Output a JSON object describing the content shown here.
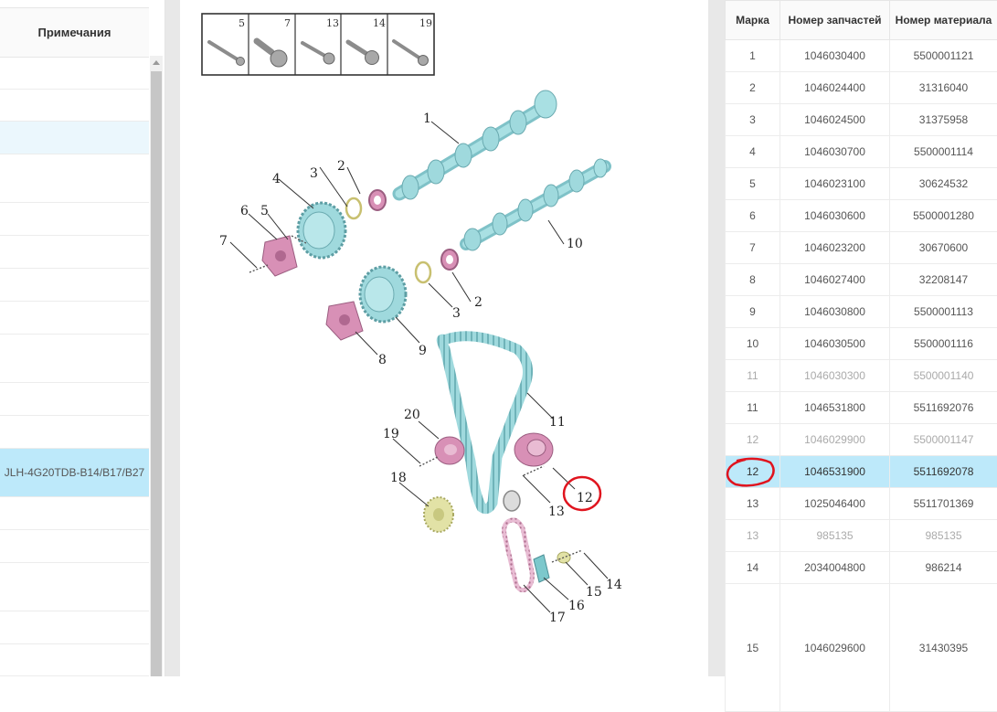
{
  "left_table": {
    "header": "Примечания",
    "selected_note": "JLH-4G20TDB-B14/B17/B27"
  },
  "diagram": {
    "bolt_legend": [
      "5",
      "7",
      "13",
      "14",
      "19"
    ],
    "callouts": [
      "1",
      "2",
      "3",
      "4",
      "5",
      "6",
      "7",
      "10",
      "2",
      "3",
      "8",
      "9",
      "11",
      "20",
      "19",
      "18",
      "12",
      "13",
      "14",
      "15",
      "16",
      "17"
    ]
  },
  "parts_table": {
    "columns": [
      "Марка",
      "Номер запчастей",
      "Номер материала"
    ],
    "rows": [
      {
        "mark": "1",
        "part": "1046030400",
        "material": "5500001121",
        "state": "normal"
      },
      {
        "mark": "2",
        "part": "1046024400",
        "material": "31316040",
        "state": "normal"
      },
      {
        "mark": "3",
        "part": "1046024500",
        "material": "31375958",
        "state": "normal"
      },
      {
        "mark": "4",
        "part": "1046030700",
        "material": "5500001114",
        "state": "normal"
      },
      {
        "mark": "5",
        "part": "1046023100",
        "material": "30624532",
        "state": "normal"
      },
      {
        "mark": "6",
        "part": "1046030600",
        "material": "5500001280",
        "state": "normal"
      },
      {
        "mark": "7",
        "part": "1046023200",
        "material": "30670600",
        "state": "normal"
      },
      {
        "mark": "8",
        "part": "1046027400",
        "material": "32208147",
        "state": "normal"
      },
      {
        "mark": "9",
        "part": "1046030800",
        "material": "5500001113",
        "state": "normal"
      },
      {
        "mark": "10",
        "part": "1046030500",
        "material": "5500001116",
        "state": "normal"
      },
      {
        "mark": "11",
        "part": "1046030300",
        "material": "5500001140",
        "state": "muted"
      },
      {
        "mark": "11",
        "part": "1046531800",
        "material": "5511692076",
        "state": "normal"
      },
      {
        "mark": "12",
        "part": "1046029900",
        "material": "5500001147",
        "state": "muted"
      },
      {
        "mark": "12",
        "part": "1046531900",
        "material": "5511692078",
        "state": "selected"
      },
      {
        "mark": "13",
        "part": "1025046400",
        "material": "5511701369",
        "state": "normal"
      },
      {
        "mark": "13",
        "part": "985135",
        "material": "985135",
        "state": "muted"
      },
      {
        "mark": "14",
        "part": "2034004800",
        "material": "986214",
        "state": "normal"
      },
      {
        "mark": "15",
        "part": "1046029600",
        "material": "31430395",
        "state": "tall"
      }
    ]
  },
  "colors": {
    "selected_row": "#bde9fa",
    "highlight_row": "#ebf7fd",
    "annotation": "#e0141e",
    "part_cyan": "#9ed8dc",
    "part_pink": "#d88fb4",
    "part_yellow": "#e2e2a6"
  }
}
